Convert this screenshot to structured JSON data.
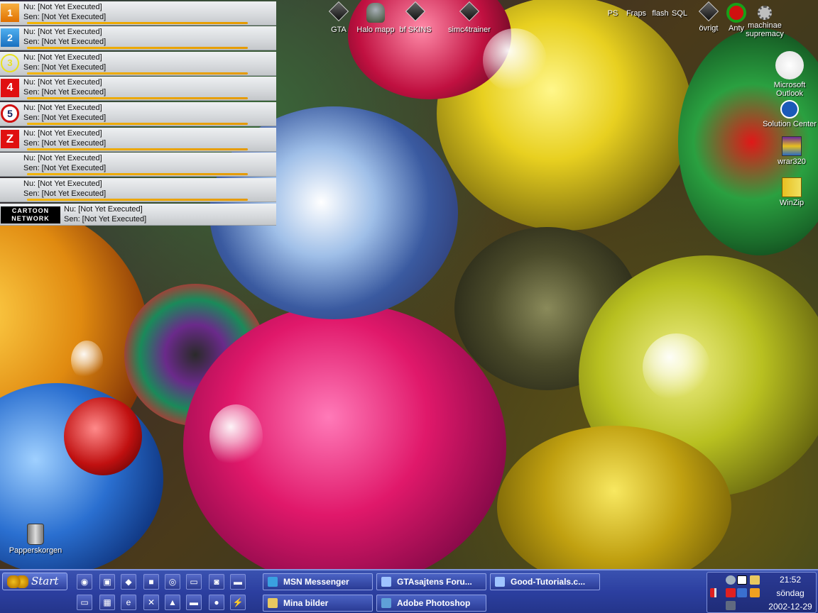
{
  "tv_guide": {
    "rows": [
      {
        "channel_logo": "1",
        "now": "Nu: [Not Yet Executed]",
        "later": "Sen: [Not Yet Executed]"
      },
      {
        "channel_logo": "2",
        "now": "Nu: [Not Yet Executed]",
        "later": "Sen: [Not Yet Executed]"
      },
      {
        "channel_logo": "3",
        "now": "Nu: [Not Yet Executed]",
        "later": "Sen: [Not Yet Executed]"
      },
      {
        "channel_logo": "4",
        "now": "Nu: [Not Yet Executed]",
        "later": "Sen: [Not Yet Executed]"
      },
      {
        "channel_logo": "5",
        "now": "Nu: [Not Yet Executed]",
        "later": "Sen: [Not Yet Executed]"
      },
      {
        "channel_logo": "Z",
        "now": "Nu: [Not Yet Executed]",
        "later": "Sen: [Not Yet Executed]"
      },
      {
        "channel_logo": "",
        "now": "Nu: [Not Yet Executed]",
        "later": "Sen: [Not Yet Executed]"
      },
      {
        "channel_logo": "",
        "now": "Nu: [Not Yet Executed]",
        "later": "Sen: [Not Yet Executed]"
      },
      {
        "channel_logo": "CARTOON NETWORK",
        "now": "Nu: [Not Yet Executed]",
        "later": "Sen: [Not Yet Executed]"
      }
    ]
  },
  "desktop_icons": {
    "gta": "GTA",
    "halo": "Halo mapp",
    "bf_skins": "bf SKINS",
    "simc4trainer": "simc4trainer",
    "ps": "PS",
    "fraps": "Fraps",
    "flash": "flash",
    "sql": "SQL",
    "ovrigt": "övrigt",
    "anty": "Anty",
    "machinae_line1": "machinae",
    "machinae_line2": "supremacy",
    "outlook_line1": "Microsoft",
    "outlook_line2": "Outlook",
    "dell": "Solution Center",
    "winrar": "wrar320",
    "winzip": "WinZip",
    "recycle_bin": "Papperskorgen"
  },
  "taskbar": {
    "start_label": "Start",
    "tasks": [
      {
        "label": "MSN Messenger",
        "icon_color": "#3aa0e0"
      },
      {
        "label": "GTAsajtens Foru...",
        "icon_color": "#9fc4ff"
      },
      {
        "label": "Good-Tutorials.c...",
        "icon_color": "#9fc4ff"
      },
      {
        "label": "Mina bilder",
        "icon_color": "#e8c860"
      },
      {
        "label": "Adobe Photoshop",
        "icon_color": "#5fa0d8"
      }
    ],
    "clock": {
      "time": "21:52",
      "day": "söndag",
      "date": "2002-12-29"
    }
  }
}
